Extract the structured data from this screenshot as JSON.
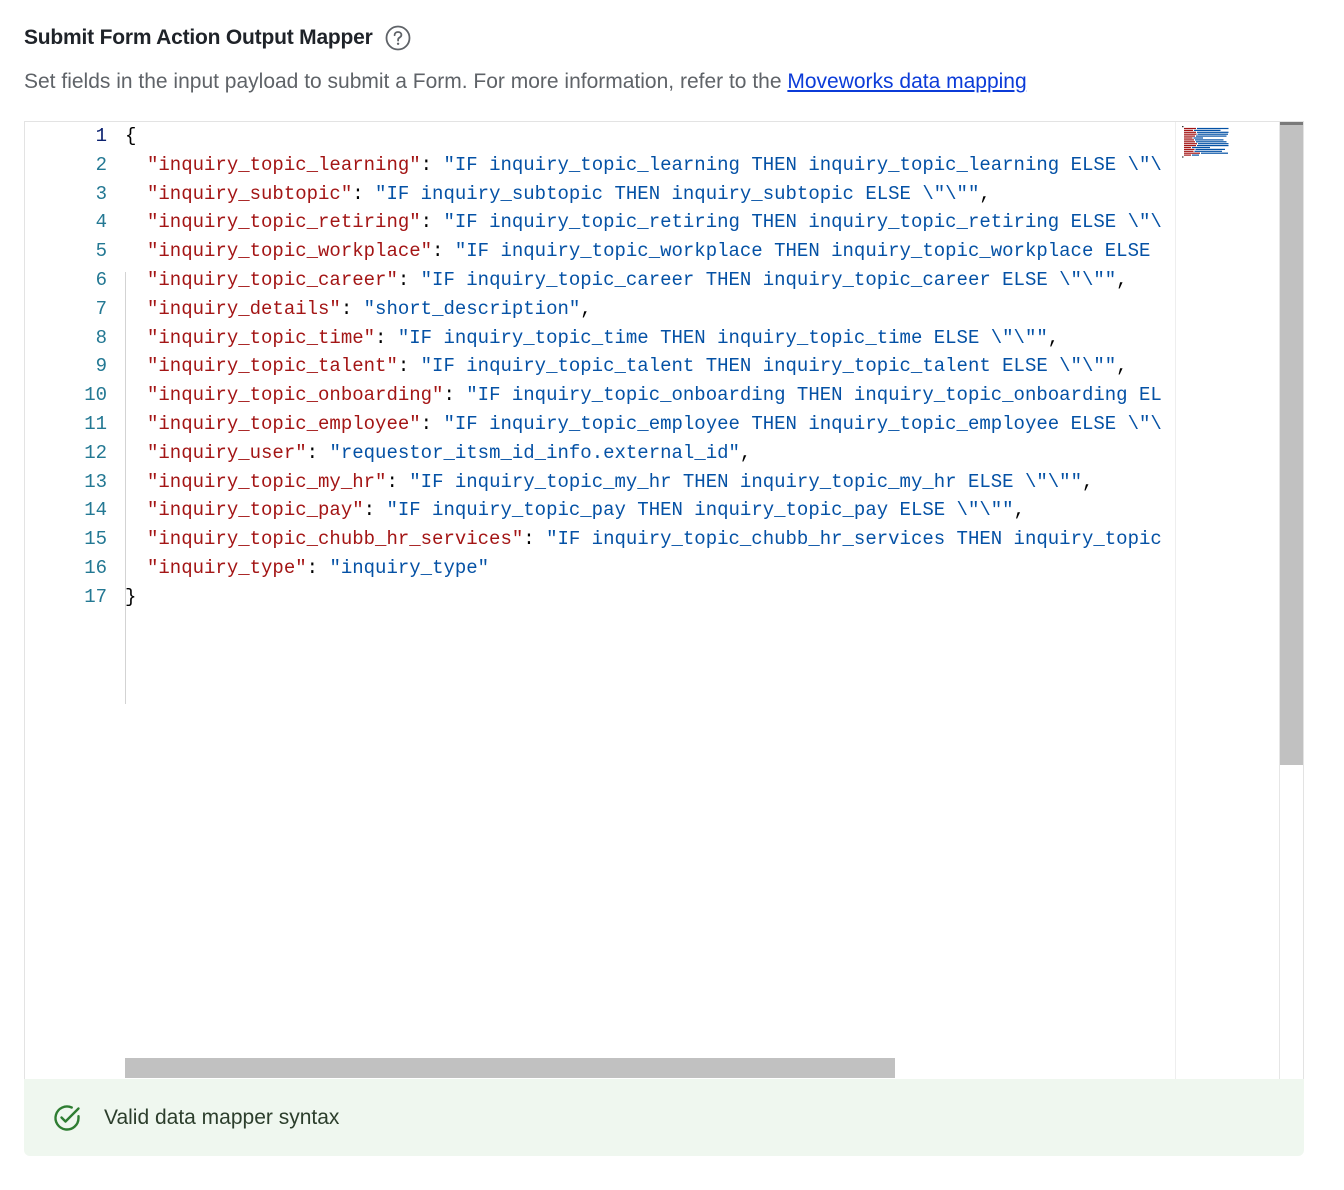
{
  "header": {
    "title": "Submit Form Action Output Mapper",
    "help_icon": "question-circle-icon"
  },
  "description": {
    "text": "Set fields in the input payload to submit a Form. For more information, refer to the ",
    "link_text": "Moveworks data mapping"
  },
  "editor": {
    "active_line": 1,
    "lines": [
      {
        "number": "1",
        "key": "",
        "sep": "{",
        "value": "",
        "tail": ""
      },
      {
        "number": "2",
        "key": "\"inquiry_topic_learning\"",
        "sep": ": ",
        "value": "\"IF inquiry_topic_learning THEN inquiry_topic_learning ELSE \\\"\\",
        "tail": ""
      },
      {
        "number": "3",
        "key": "\"inquiry_subtopic\"",
        "sep": ": ",
        "value": "\"IF inquiry_subtopic THEN inquiry_subtopic ELSE \\\"\\\"\"",
        "tail": ","
      },
      {
        "number": "4",
        "key": "\"inquiry_topic_retiring\"",
        "sep": ": ",
        "value": "\"IF inquiry_topic_retiring THEN inquiry_topic_retiring ELSE \\\"\\",
        "tail": ""
      },
      {
        "number": "5",
        "key": "\"inquiry_topic_workplace\"",
        "sep": ": ",
        "value": "\"IF inquiry_topic_workplace THEN inquiry_topic_workplace ELSE",
        "tail": ""
      },
      {
        "number": "6",
        "key": "\"inquiry_topic_career\"",
        "sep": ": ",
        "value": "\"IF inquiry_topic_career THEN inquiry_topic_career ELSE \\\"\\\"\"",
        "tail": ","
      },
      {
        "number": "7",
        "key": "\"inquiry_details\"",
        "sep": ": ",
        "value": "\"short_description\"",
        "tail": ","
      },
      {
        "number": "8",
        "key": "\"inquiry_topic_time\"",
        "sep": ": ",
        "value": "\"IF inquiry_topic_time THEN inquiry_topic_time ELSE \\\"\\\"\"",
        "tail": ","
      },
      {
        "number": "9",
        "key": "\"inquiry_topic_talent\"",
        "sep": ": ",
        "value": "\"IF inquiry_topic_talent THEN inquiry_topic_talent ELSE \\\"\\\"\"",
        "tail": ","
      },
      {
        "number": "10",
        "key": "\"inquiry_topic_onboarding\"",
        "sep": ": ",
        "value": "\"IF inquiry_topic_onboarding THEN inquiry_topic_onboarding EL",
        "tail": ""
      },
      {
        "number": "11",
        "key": "\"inquiry_topic_employee\"",
        "sep": ": ",
        "value": "\"IF inquiry_topic_employee THEN inquiry_topic_employee ELSE \\\"\\",
        "tail": ""
      },
      {
        "number": "12",
        "key": "\"inquiry_user\"",
        "sep": ": ",
        "value": "\"requestor_itsm_id_info.external_id\"",
        "tail": ","
      },
      {
        "number": "13",
        "key": "\"inquiry_topic_my_hr\"",
        "sep": ": ",
        "value": "\"IF inquiry_topic_my_hr THEN inquiry_topic_my_hr ELSE \\\"\\\"\"",
        "tail": ","
      },
      {
        "number": "14",
        "key": "\"inquiry_topic_pay\"",
        "sep": ": ",
        "value": "\"IF inquiry_topic_pay THEN inquiry_topic_pay ELSE \\\"\\\"\"",
        "tail": ","
      },
      {
        "number": "15",
        "key": "\"inquiry_topic_chubb_hr_services\"",
        "sep": ": ",
        "value": "\"IF inquiry_topic_chubb_hr_services THEN inquiry_topic",
        "tail": ""
      },
      {
        "number": "16",
        "key": "\"inquiry_type\"",
        "sep": ": ",
        "value": "\"inquiry_type\"",
        "tail": ""
      },
      {
        "number": "17",
        "key": "",
        "sep": "}",
        "value": "",
        "tail": ""
      }
    ]
  },
  "status": {
    "icon": "check-circle-icon",
    "text": "Valid data mapper syntax",
    "color": "#2e7d32"
  },
  "colors": {
    "key": "#a31515",
    "value": "#0451a5",
    "line_number": "#237893",
    "link": "#0b3bd8",
    "status_bg": "#eff7ef"
  }
}
